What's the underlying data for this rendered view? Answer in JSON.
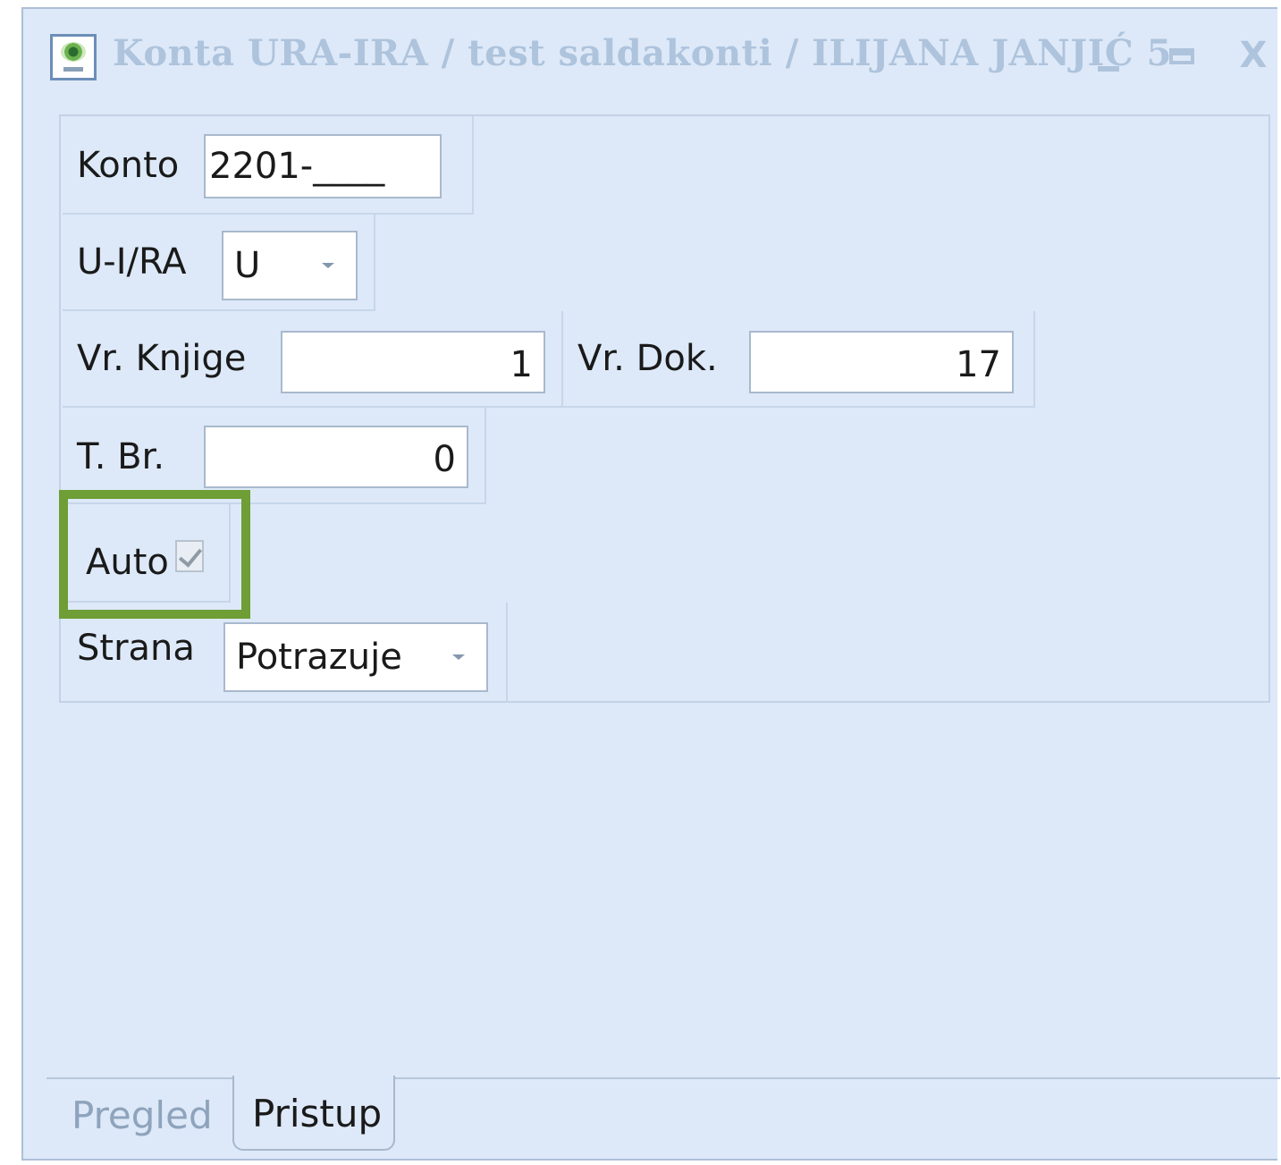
{
  "window": {
    "title": "Konta URA-IRA / test saldakonti / ILIJANA JANJIĆ  5",
    "controls": {
      "minimize": "_",
      "maximize": "□",
      "close": "X"
    },
    "icon": "app-eye-icon"
  },
  "form": {
    "konto": {
      "label": "Konto",
      "value": "2201-____"
    },
    "ui_ra": {
      "label": "U-I/RA",
      "value": "U"
    },
    "vr_knjige": {
      "label": "Vr. Knjige",
      "value": "1"
    },
    "vr_dok": {
      "label": "Vr. Dok.",
      "value": "17"
    },
    "t_br": {
      "label": "T. Br.",
      "value": "0"
    },
    "auto": {
      "label": "Auto",
      "checked": true
    },
    "strana": {
      "label": "Strana",
      "value": "Potrazuje"
    }
  },
  "highlight_color": "#6e9e35",
  "tabs": [
    {
      "label": "Pregled",
      "active": false
    },
    {
      "label": "Pristup",
      "active": true
    }
  ]
}
